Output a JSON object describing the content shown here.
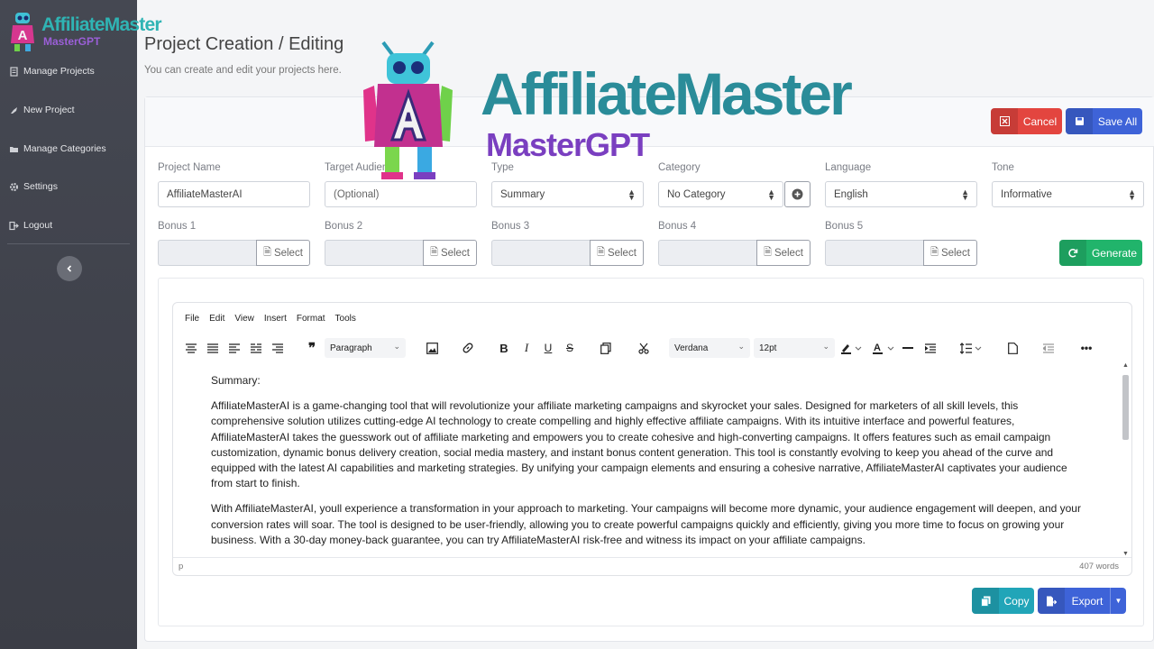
{
  "app": {
    "logo_title": "AffiliateMaster",
    "logo_subtitle": "MasterGPT"
  },
  "sidebar": {
    "items": [
      {
        "label": "Manage Projects",
        "icon": "file-icon"
      },
      {
        "label": "New Project",
        "icon": "rocket-icon"
      },
      {
        "label": "Manage Categories",
        "icon": "folder-icon"
      },
      {
        "label": "Settings",
        "icon": "gear-icon"
      },
      {
        "label": "Logout",
        "icon": "logout-icon"
      }
    ]
  },
  "header": {
    "title": "Project Creation / Editing",
    "subtitle": "You can create and edit your projects here."
  },
  "actions": {
    "cancel_label": "Cancel",
    "save_label": "Save All",
    "generate_label": "Generate",
    "copy_label": "Copy",
    "export_label": "Export"
  },
  "form": {
    "project_name_label": "Project Name",
    "project_name_value": "AffiliateMasterAI",
    "target_audience_label": "Target Audience",
    "target_audience_placeholder": "(Optional)",
    "type_label": "Type",
    "type_value": "Summary",
    "category_label": "Category",
    "category_value": "No Category",
    "language_label": "Language",
    "language_value": "English",
    "tone_label": "Tone",
    "tone_value": "Informative",
    "bonuses": [
      {
        "label": "Bonus 1",
        "button": "Select"
      },
      {
        "label": "Bonus 2",
        "button": "Select"
      },
      {
        "label": "Bonus 3",
        "button": "Select"
      },
      {
        "label": "Bonus 4",
        "button": "Select"
      },
      {
        "label": "Bonus 5",
        "button": "Select"
      }
    ]
  },
  "editor": {
    "menu": [
      "File",
      "Edit",
      "View",
      "Insert",
      "Format",
      "Tools"
    ],
    "block_format": "Paragraph",
    "font_family": "Verdana",
    "font_size": "12pt",
    "heading": "Summary:",
    "paragraph1": "AffiliateMasterAI is a game-changing tool that will revolutionize your affiliate marketing campaigns and skyrocket your sales. Designed for marketers of all skill levels, this comprehensive solution utilizes cutting-edge AI technology to create compelling and highly effective affiliate campaigns. With its intuitive interface and powerful features, AffiliateMasterAI takes the guesswork out of affiliate marketing and empowers you to create cohesive and high-converting campaigns. It offers features such as email campaign customization, dynamic bonus delivery creation, social media mastery, and instant bonus content generation. This tool is constantly evolving to keep you ahead of the curve and equipped with the latest AI capabilities and marketing strategies. By unifying your campaign elements and ensuring a cohesive narrative, AffiliateMasterAI captivates your audience from start to finish.",
    "paragraph2": "With AffiliateMasterAI, youll experience a transformation in your approach to marketing. Your campaigns will become more dynamic, your audience engagement will deepen, and your conversion rates will soar. The tool is designed to be user-friendly, allowing you to create powerful campaigns quickly and efficiently, giving you more time to focus on growing your business. With a 30-day money-back guarantee, you can try AffiliateMasterAI risk-free and witness its impact on your affiliate campaigns.",
    "status_path": "p",
    "word_count": "407 words"
  },
  "watermark": {
    "title": "AffiliateMaster",
    "subtitle": "MasterGPT"
  },
  "colors": {
    "cancel": "#e3453f",
    "save": "#3e63d8",
    "generate": "#21b46b",
    "copy": "#21a5b8",
    "sidebar": "#41434c",
    "brand_teal": "#2a8c99",
    "brand_purple": "#7a3fc0"
  }
}
